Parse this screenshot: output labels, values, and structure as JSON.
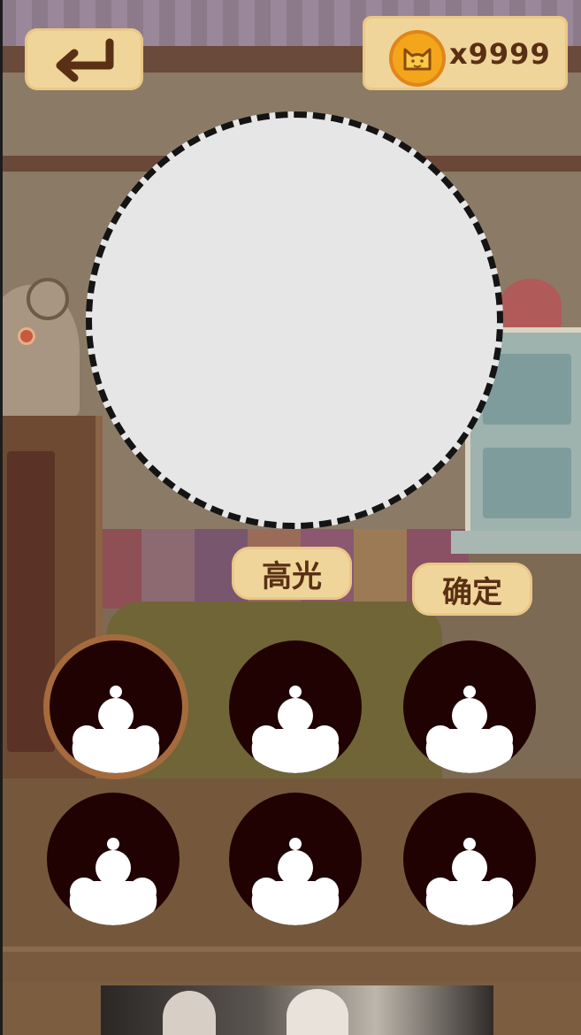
{
  "header": {
    "back_icon": "return-arrow-icon",
    "coin_icon": "cat-coin-icon",
    "coin_count": "x9999"
  },
  "portrait": {
    "state": "empty"
  },
  "buttons": {
    "highlight_label": "高光",
    "confirm_label": "确定"
  },
  "slots": {
    "icon": "mascot-silhouette-icon",
    "count": 6,
    "selected_index": 0
  },
  "colors": {
    "panel": "#f0d59b",
    "text_brown": "#5a3014",
    "slot_bg": "#200203",
    "coin": "#f3a51c",
    "selected_ring": "#a66b3c"
  }
}
